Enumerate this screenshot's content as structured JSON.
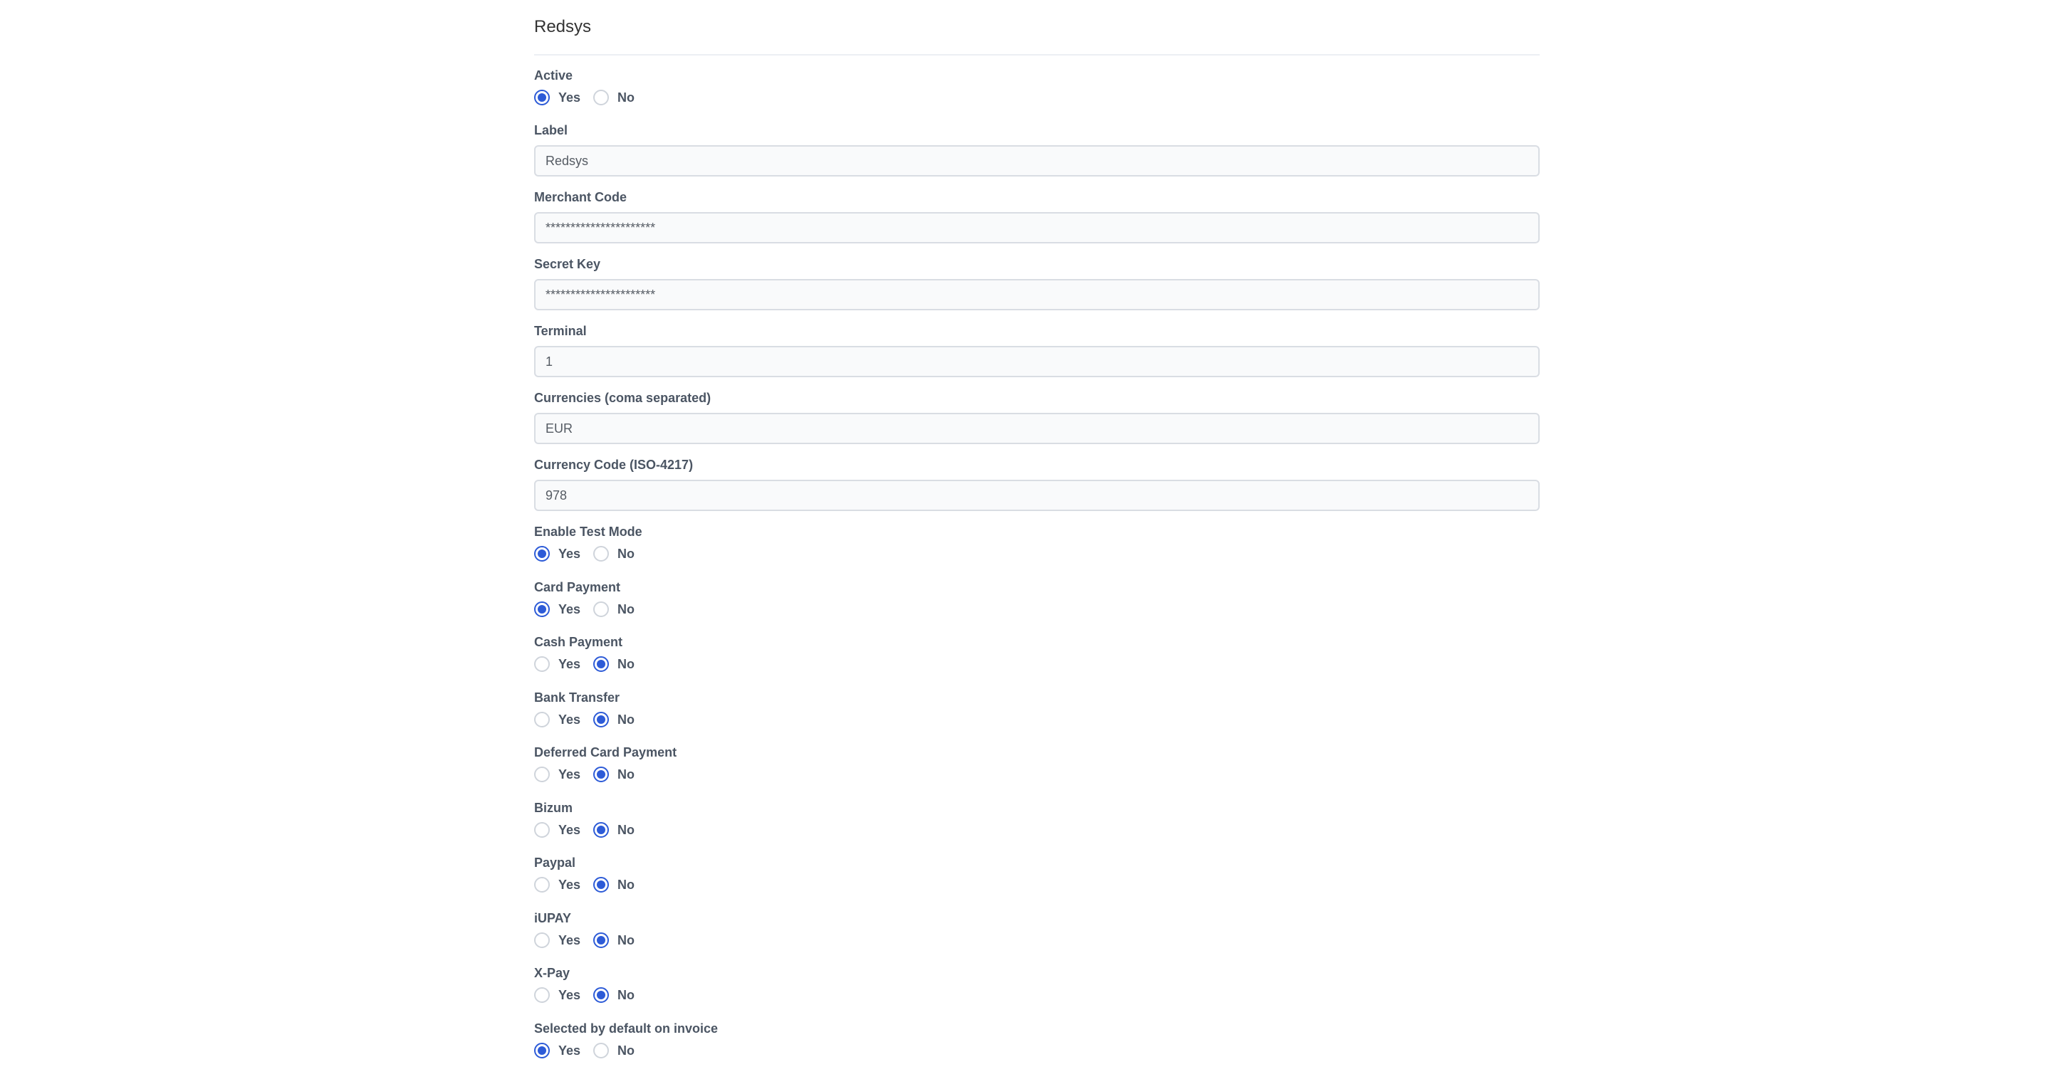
{
  "header": {
    "title": "Redsys"
  },
  "fields": {
    "active": {
      "label": "Active",
      "options": [
        "Yes",
        "No"
      ],
      "selected": "Yes"
    },
    "label": {
      "label": "Label",
      "value": "Redsys"
    },
    "merchant_code": {
      "label": "Merchant Code",
      "value": "**********************"
    },
    "secret_key": {
      "label": "Secret Key",
      "value": "**********************"
    },
    "terminal": {
      "label": "Terminal",
      "value": "1"
    },
    "currencies": {
      "label": "Currencies (coma separated)",
      "value": "EUR"
    },
    "currency_code": {
      "label": "Currency Code (ISO-4217)",
      "value": "978"
    },
    "enable_test_mode": {
      "label": "Enable Test Mode",
      "options": [
        "Yes",
        "No"
      ],
      "selected": "Yes"
    },
    "card_payment": {
      "label": "Card Payment",
      "options": [
        "Yes",
        "No"
      ],
      "selected": "Yes"
    },
    "cash_payment": {
      "label": "Cash Payment",
      "options": [
        "Yes",
        "No"
      ],
      "selected": "No"
    },
    "bank_transfer": {
      "label": "Bank Transfer",
      "options": [
        "Yes",
        "No"
      ],
      "selected": "No"
    },
    "deferred_card_payment": {
      "label": "Deferred Card Payment",
      "options": [
        "Yes",
        "No"
      ],
      "selected": "No"
    },
    "bizum": {
      "label": "Bizum",
      "options": [
        "Yes",
        "No"
      ],
      "selected": "No"
    },
    "paypal": {
      "label": "Paypal",
      "options": [
        "Yes",
        "No"
      ],
      "selected": "No"
    },
    "iupay": {
      "label": "iUPAY",
      "options": [
        "Yes",
        "No"
      ],
      "selected": "No"
    },
    "xpay": {
      "label": "X-Pay",
      "options": [
        "Yes",
        "No"
      ],
      "selected": "No"
    },
    "selected_default_invoice": {
      "label": "Selected by default on invoice",
      "options": [
        "Yes",
        "No"
      ],
      "selected": "Yes"
    }
  },
  "colors": {
    "accent": "#2d5bd7",
    "input_bg": "#f9fafb",
    "input_border": "#d9dde3"
  }
}
